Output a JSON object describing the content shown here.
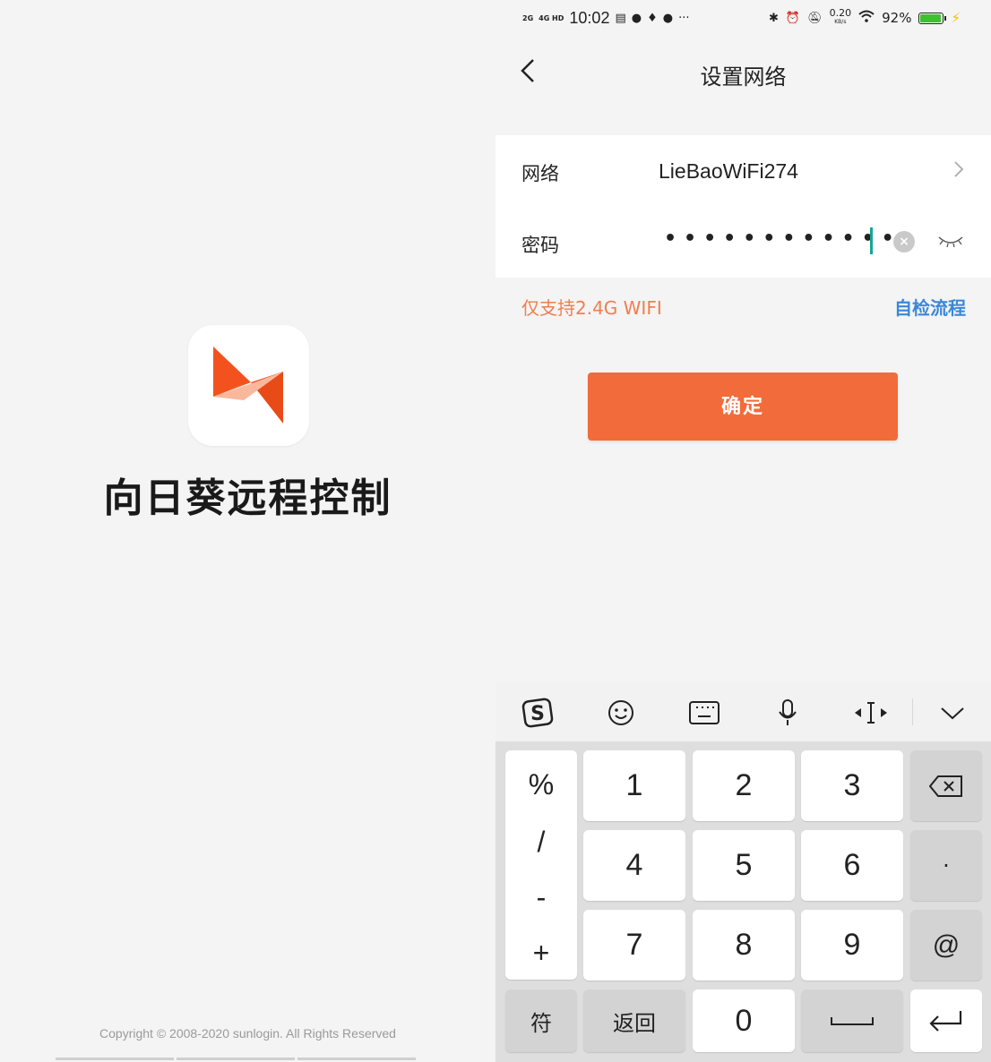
{
  "splash": {
    "app_name": "向日葵远程控制",
    "copyright": "Copyright © 2008-2020 sunlogin. All Rights Reserved"
  },
  "status_bar": {
    "sim1": "2G",
    "sim2": "4G HD",
    "time": "10:02",
    "speed_value": "0.20",
    "speed_unit": "KB/s",
    "battery_percent_text": "92%",
    "battery_level": 0.92
  },
  "nav": {
    "title": "设置网络",
    "back_icon": "chevron-left-icon"
  },
  "form": {
    "network_label": "网络",
    "network_value": "LieBaoWiFi274",
    "password_label": "密码",
    "password_mask": "••••••••••••"
  },
  "hint": {
    "only_24g": "仅支持2.4G WIFI",
    "self_check": "自检流程"
  },
  "confirm_label": "确定",
  "colors": {
    "accent": "#f26b3a",
    "hint": "#f07e4e",
    "link": "#3b87d9",
    "caret": "#17a499",
    "battery": "#3ec12e"
  },
  "keyboard": {
    "toolbar_icons": [
      "sogou-logo-icon",
      "emoji-icon",
      "keyboard-icon",
      "microphone-icon",
      "cursor-move-icon",
      "collapse-icon"
    ],
    "symbols": [
      "%",
      "/",
      "-",
      "+"
    ],
    "digits": [
      "1",
      "2",
      "3",
      "4",
      "5",
      "6",
      "7",
      "8",
      "9",
      "0"
    ],
    "dot": "·",
    "at": "@",
    "fu": "符",
    "back": "返回"
  }
}
